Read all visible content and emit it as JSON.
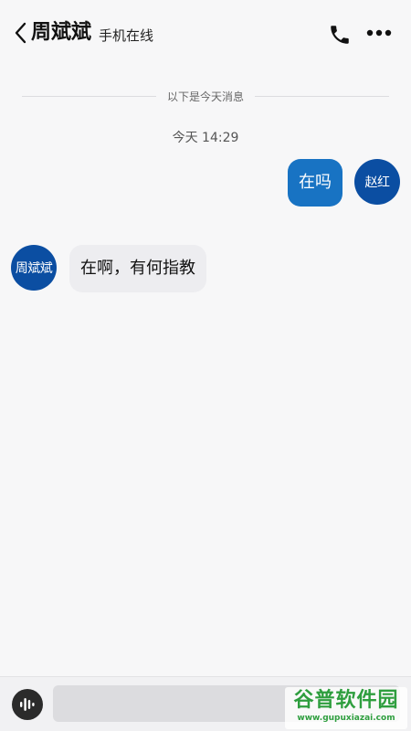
{
  "header": {
    "title": "周斌斌",
    "status": "手机在线"
  },
  "chat": {
    "divider_text": "以下是今天消息",
    "timestamp": "今天 14:29",
    "messages": [
      {
        "sender": "me",
        "avatar_text": "赵红",
        "text": "在吗"
      },
      {
        "sender": "other",
        "avatar_text": "周斌斌",
        "text": "在啊，有何指教"
      }
    ]
  },
  "input": {
    "value": "",
    "placeholder": ""
  },
  "watermark": {
    "main": "谷普软件园",
    "url": "www.gupuxiazai.com"
  },
  "icons": {
    "back": "chevron-left-icon",
    "phone": "phone-icon",
    "more": "more-dots-icon",
    "voice": "voice-wave-icon"
  },
  "colors": {
    "accent": "#1873c3",
    "avatar": "#0b4ea2",
    "incoming_bubble": "#ededf0",
    "background": "#f7f7f8",
    "watermark": "#2e9e3e"
  }
}
